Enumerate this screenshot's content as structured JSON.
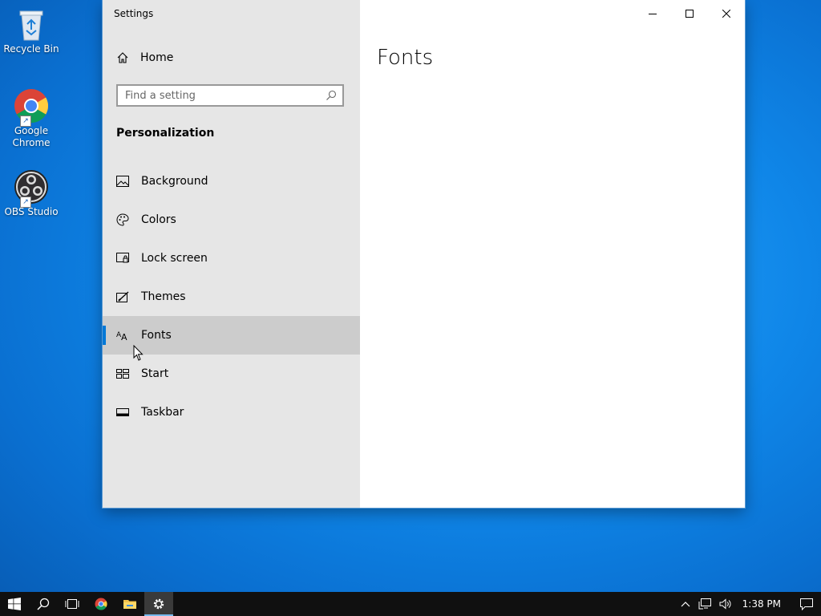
{
  "desktop": {
    "icons": [
      {
        "label": "Recycle Bin"
      },
      {
        "label": "Google Chrome"
      },
      {
        "label": "OBS Studio"
      }
    ]
  },
  "window": {
    "title": "Settings",
    "controls": {
      "minimize": "minimize-icon",
      "maximize": "maximize-icon",
      "close": "close-icon"
    }
  },
  "sidebar": {
    "home_label": "Home",
    "search_placeholder": "Find a setting",
    "section_heading": "Personalization",
    "items": [
      {
        "label": "Background",
        "icon": "picture-icon"
      },
      {
        "label": "Colors",
        "icon": "palette-icon"
      },
      {
        "label": "Lock screen",
        "icon": "lock-screen-icon"
      },
      {
        "label": "Themes",
        "icon": "themes-icon"
      },
      {
        "label": "Fonts",
        "icon": "fonts-icon",
        "selected": true
      },
      {
        "label": "Start",
        "icon": "start-icon"
      },
      {
        "label": "Taskbar",
        "icon": "taskbar-icon"
      }
    ]
  },
  "content": {
    "page_title": "Fonts"
  },
  "taskbar": {
    "clock": "1:38 PM",
    "accent": "#0078d7"
  }
}
